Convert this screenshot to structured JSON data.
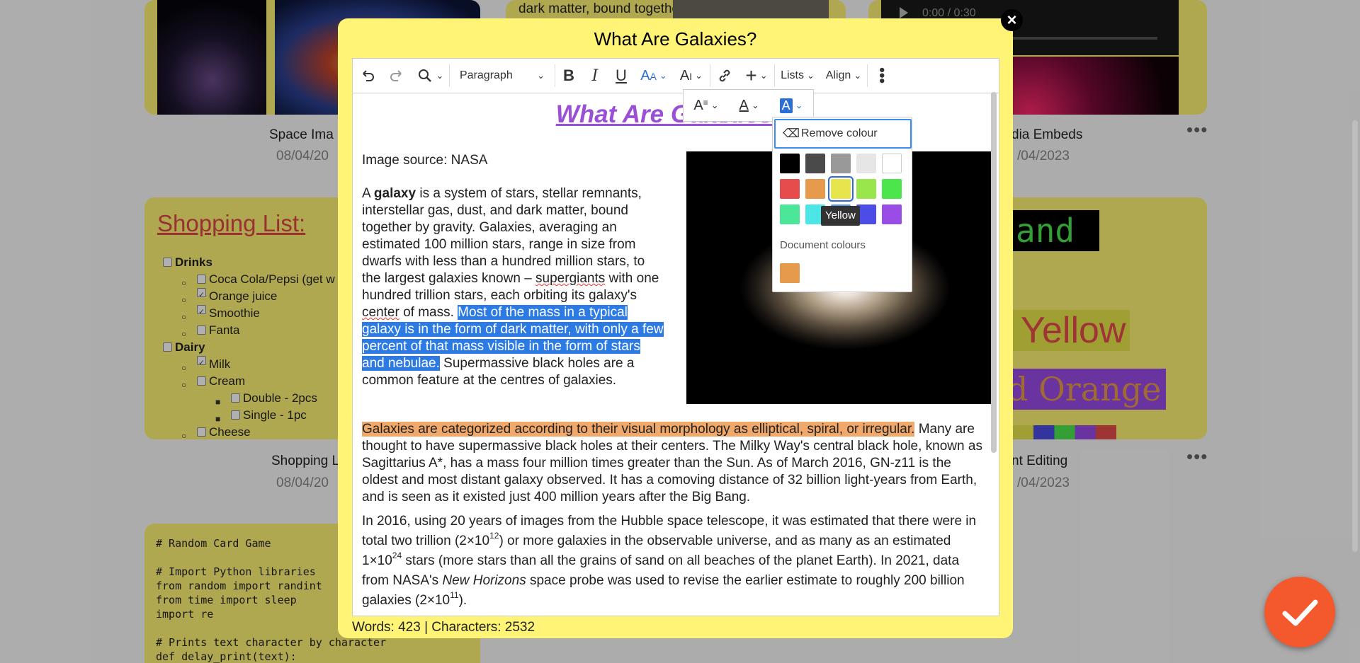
{
  "modal": {
    "title": "What Are Galaxies?",
    "word_count": "Words: 423 | Characters: 2532"
  },
  "toolbar": {
    "paragraph_label": "Paragraph",
    "lists_label": "Lists",
    "align_label": "Align"
  },
  "colour_panel": {
    "remove_label": "Remove colour",
    "tooltip": "Yellow",
    "document_colours_label": "Document colours",
    "swatches": [
      "#000000",
      "#4a4a4a",
      "#999999",
      "#e6e6e6",
      "#ffffff",
      "#e64c4c",
      "#e69a4c",
      "#e6e64c",
      "#99e64c",
      "#4ce64c",
      "#4ce699",
      "#4ce6e6",
      "#4c99e6",
      "#4c4ce6",
      "#994ce6"
    ],
    "document_swatches": [
      "#e69a4c"
    ]
  },
  "editor": {
    "doc_title": "What Are Galaxies?",
    "image_source": "Image source: NASA",
    "p1_a": "A ",
    "p1_bold": "galaxy",
    "p1_b": " is a system of stars, stellar remnants, interstellar gas, dust, and dark matter, bound together by gravity. Galaxies, averaging an estimated 100 million stars, range in size from dwarfs with less than a hundred million stars, to the largest galaxies known – ",
    "p1_supergiants": "supergiants",
    "p1_c": " with one hundred trillion stars, each orbiting its galaxy's ",
    "p1_center": "center",
    "p1_d": " of mass. ",
    "p1_selected": "Most of the mass in a typical galaxy is in the form of dark matter, with only a few percent of that mass visible in the form of stars and nebulae.",
    "p1_e": " Supermassive black holes are a common feature at the centres of galaxies.",
    "p2_highlight": "Galaxies are categorized according to their visual morphology as elliptical, spiral, or irregular.",
    "p2_rest": " Many are thought to have supermassive black holes at their centers. The Milky Way's central black hole, known as Sagittarius A*, has a mass four million times greater than the Sun. As of March 2016, GN-z11 is the oldest and most distant galaxy observed. It has a comoving distance of 32 billion light-years from Earth, and is seen as it existed just 400 million years after the Big Bang.",
    "p3_a": "In 2016, using 20 years of images from the Hubble space telescope, it was estimated that there were in total two trillion (2×10",
    "p3_sup1": "12",
    "p3_b": ") or more galaxies in the observable universe, and as many as an estimated 1×10",
    "p3_sup2": "24",
    "p3_c": " stars (more stars than all the grains of sand on all beaches of the planet Earth). In 2021, data from NASA's ",
    "p3_italic": "New Horizons",
    "p3_d": " space probe was used to revise the earlier estimate to roughly 200 billion galaxies (2×10",
    "p3_sup3": "11",
    "p3_e": ")."
  },
  "background": {
    "space_caption": "Space Ima",
    "space_date": "08/04/20",
    "media_caption": "dia Embeds",
    "media_date": "/04/2023",
    "shopping_title": "Shopping List:",
    "shopping_caption": "Shopping L",
    "shopping_date": "08/04/20",
    "font_caption": "nt Editing",
    "font_date": "/04/2023",
    "dark_matter_snippet": "dark matter, bound together",
    "video_time": "0:00 / 0:30",
    "font_sample_1": "and",
    "font_sample_2": "l Yellow",
    "font_sample_3": "d Orange",
    "shopping_items": [
      {
        "label": "Drinks",
        "level": 0,
        "checked": false,
        "bold": true
      },
      {
        "label": "Coca Cola/Pepsi (get w",
        "level": 1,
        "checked": false
      },
      {
        "label": "Orange juice",
        "level": 1,
        "checked": true
      },
      {
        "label": "Smoothie",
        "level": 1,
        "checked": true
      },
      {
        "label": "Fanta",
        "level": 1,
        "checked": false
      },
      {
        "label": "Dairy",
        "level": 0,
        "checked": false,
        "bold": true
      },
      {
        "label": "Milk",
        "level": 1,
        "checked": true
      },
      {
        "label": "Cream",
        "level": 1,
        "checked": false
      },
      {
        "label": "Double - 2pcs",
        "level": 2,
        "checked": false
      },
      {
        "label": "Single - 1pc",
        "level": 2,
        "checked": false
      },
      {
        "label": "Cheese",
        "level": 1,
        "checked": false
      }
    ],
    "code_lines": "# Random Card Game\n\n# Import Python libraries\nfrom random import randint\nfrom time import sleep\nimport re\n\n# Prints text character by character\ndef delay_print(text):"
  }
}
